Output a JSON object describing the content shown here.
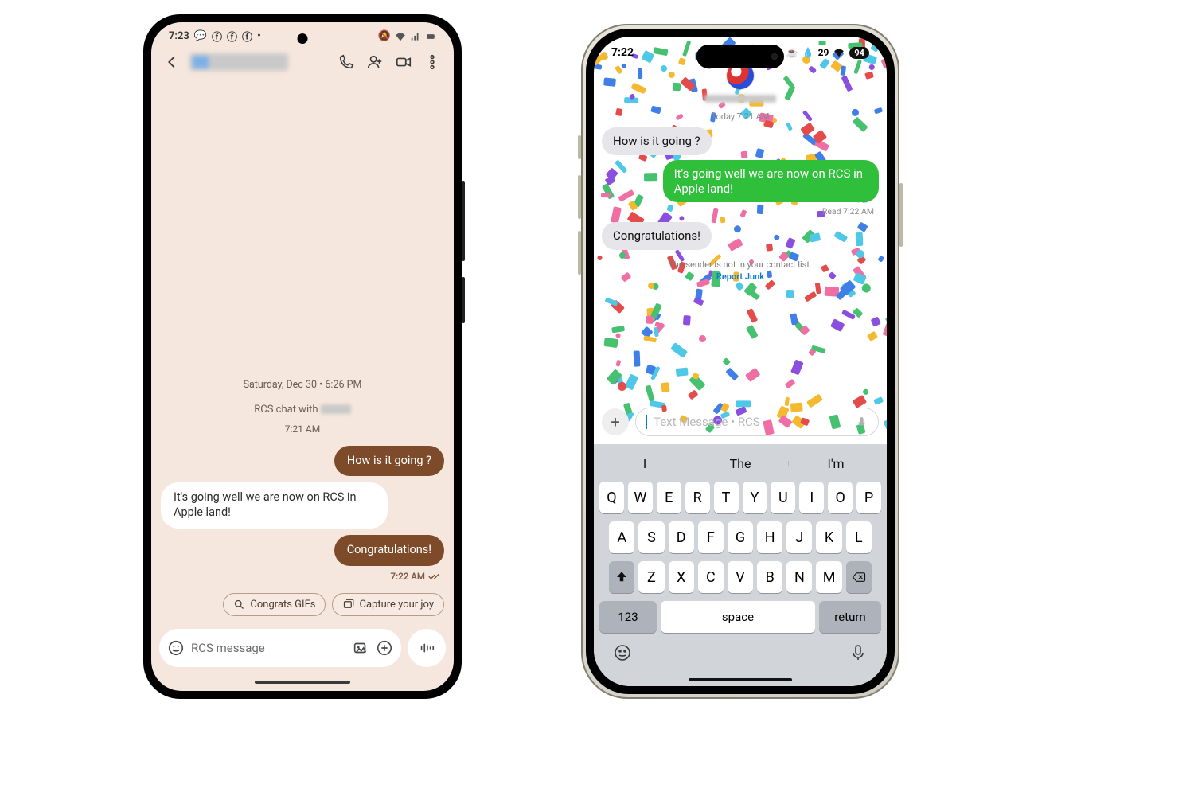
{
  "android": {
    "status": {
      "time": "7:23",
      "icons": "🔕 📶 🔋"
    },
    "header": {
      "call": "Call",
      "add": "Add person",
      "video": "Video",
      "more": "More"
    },
    "timeline": {
      "date": "Saturday, Dec 30 • 6:26 PM",
      "chat_with": "RCS chat with ",
      "time2": "7:21 AM",
      "msg_out1": "How is it going ?",
      "msg_in1": "It's going well we are now on RCS in Apple land!",
      "msg_out2": "Congratulations!",
      "read_ts": "7:22 AM"
    },
    "chips": {
      "c1": "Congrats GIFs",
      "c2": "Capture your joy"
    },
    "composer": {
      "placeholder": "RCS message"
    }
  },
  "ios": {
    "status": {
      "time": "7:22",
      "temp": "29",
      "battery": "94"
    },
    "date_row": "Today 7:21 AM",
    "messages": {
      "in1": "How is it going ?",
      "out1": "It's going well we are now on RCS in Apple land!",
      "read": "Read 7:22 AM",
      "in2": "Congratulations!"
    },
    "warning": "The sender is not in your contact list.",
    "report": "Report Junk",
    "composer": {
      "placeholder": "Text Message • RCS"
    },
    "suggestions": [
      "I",
      "The",
      "I'm"
    ],
    "keyboard": {
      "r1": [
        "Q",
        "W",
        "E",
        "R",
        "T",
        "Y",
        "U",
        "I",
        "O",
        "P"
      ],
      "r2": [
        "A",
        "S",
        "D",
        "F",
        "G",
        "H",
        "J",
        "K",
        "L"
      ],
      "r3": [
        "Z",
        "X",
        "C",
        "V",
        "B",
        "N",
        "M"
      ],
      "numLabel": "123",
      "spaceLabel": "space",
      "returnLabel": "return"
    }
  }
}
